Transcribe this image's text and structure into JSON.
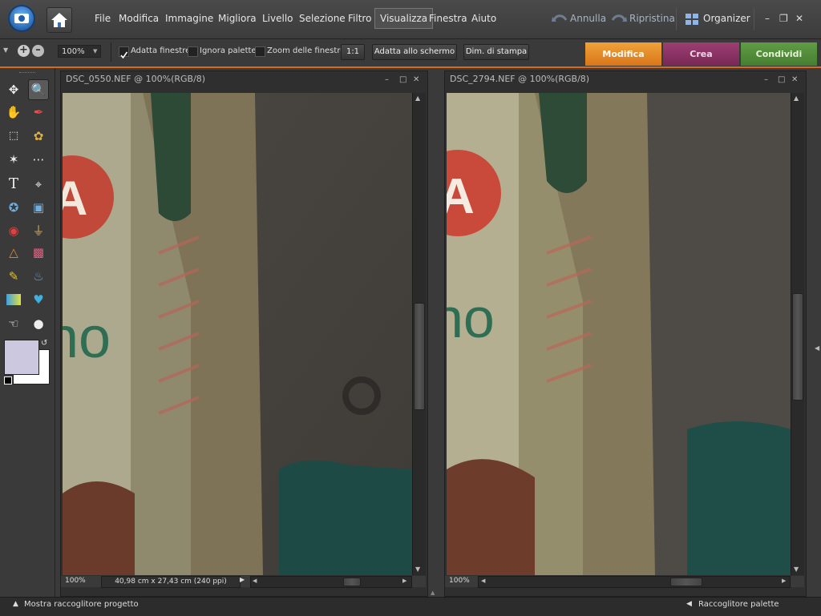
{
  "menu": {
    "items": [
      "File",
      "Modifica",
      "Immagine",
      "Migliora",
      "Livello",
      "Selezione",
      "Filtro",
      "Visualizza",
      "Finestra",
      "Aiuto"
    ],
    "active": "Visualizza",
    "undo": "Annulla",
    "redo": "Ripristina",
    "organizer": "Organizer"
  },
  "options": {
    "zoom_value": "100%",
    "fit_windows": "Adatta finestre",
    "ignore_palettes": "Ignora palette",
    "zoom_windows": "Zoom delle finestre",
    "one_to_one": "1:1",
    "fit_screen": "Adatta allo schermo",
    "print_size": "Dim. di stampa"
  },
  "tabs": {
    "edit": "Modifica",
    "create": "Crea",
    "share": "Condividi"
  },
  "documents": [
    {
      "title": "DSC_0550.NEF @ 100%(RGB/8)",
      "zoom": "100%",
      "info": "40,98 cm x 27,43 cm (240 ppi)"
    },
    {
      "title": "DSC_2794.NEF @ 100%(RGB/8)",
      "zoom": "100%"
    }
  ],
  "bottom": {
    "project_bin": "Mostra raccoglitore progetto",
    "palette_bin": "Raccoglitore palette"
  },
  "colors": {
    "accent_orange": "#d86a1a",
    "tab_edit": "#e08a1e",
    "tab_create": "#8a2f62",
    "tab_share": "#4f8a3a",
    "foreground_swatch": "#ccc8e0"
  }
}
